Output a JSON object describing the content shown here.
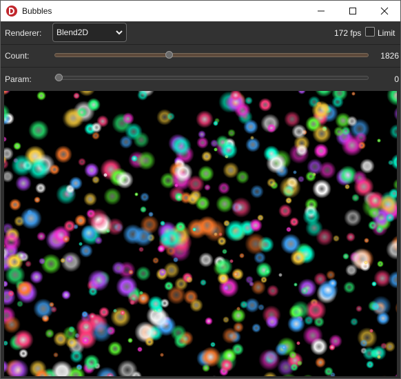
{
  "window": {
    "title": "Bubbles",
    "icon": "app-logo-icon",
    "controls": [
      "minimize-icon",
      "maximize-icon",
      "close-icon"
    ]
  },
  "toolbar": {
    "renderer_label": "Renderer:",
    "renderer_value": "Blend2D",
    "fps": "172 fps",
    "limit_label": "Limit",
    "limit_checked": false,
    "count_label": "Count:",
    "count_value": "1826",
    "count_slider_fraction": 0.36,
    "param_label": "Param:",
    "param_value": "0",
    "param_slider_fraction": 0.0
  },
  "colors": {
    "accent_count_track": "#5d4a3b",
    "canvas_bg": "#000000"
  }
}
